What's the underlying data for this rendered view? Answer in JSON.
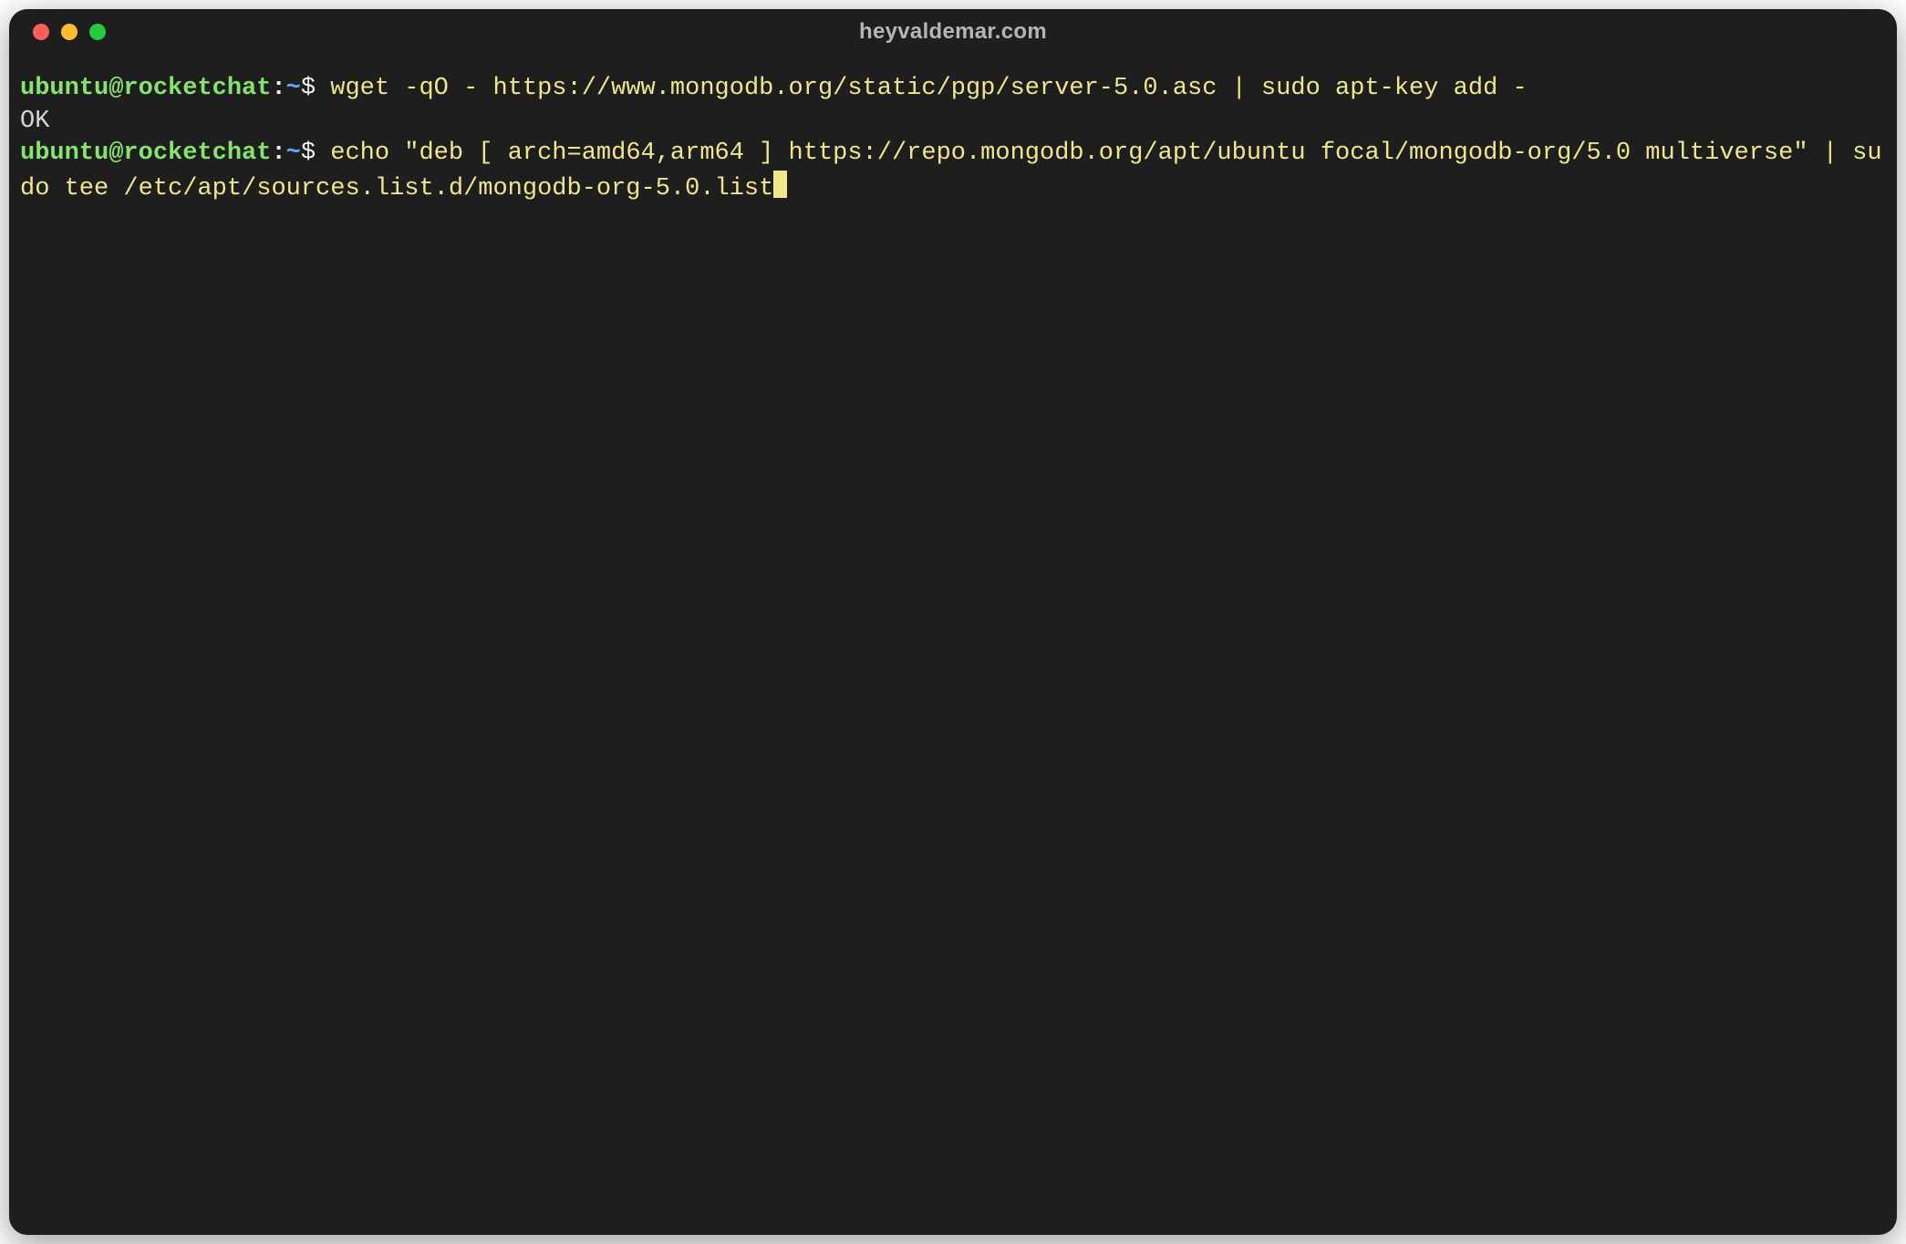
{
  "window": {
    "title": "heyvaldemar.com"
  },
  "prompt": {
    "user": "ubuntu",
    "at": "@",
    "host": "rocketchat",
    "colon": ":",
    "path": "~",
    "symbol": "$"
  },
  "lines": {
    "cmd1": "wget -qO - https://www.mongodb.org/static/pgp/server-5.0.asc | sudo apt-key add -",
    "out1": "OK",
    "cmd2": "echo \"deb [ arch=amd64,arm64 ] https://repo.mongodb.org/apt/ubuntu focal/mongodb-org/5.0 multiverse\" | sudo tee /etc/apt/sources.list.d/mongodb-org-5.0.list"
  }
}
